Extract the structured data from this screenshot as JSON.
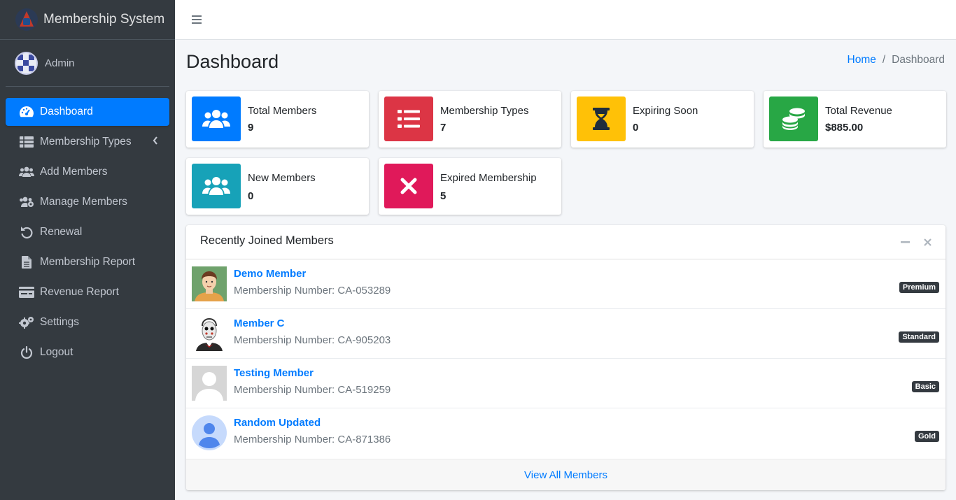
{
  "brand": {
    "title": "Membership System"
  },
  "user": {
    "name": "Admin"
  },
  "sidebar": {
    "items": [
      {
        "label": "Dashboard",
        "icon": "dashboard-icon",
        "active": true
      },
      {
        "label": "Membership Types",
        "icon": "table-icon",
        "has_caret": true
      },
      {
        "label": "Add Members",
        "icon": "users-icon"
      },
      {
        "label": "Manage Members",
        "icon": "users-cog-icon"
      },
      {
        "label": "Renewal",
        "icon": "undo-icon"
      },
      {
        "label": "Membership Report",
        "icon": "file-icon"
      },
      {
        "label": "Revenue Report",
        "icon": "money-check-icon"
      },
      {
        "label": "Settings",
        "icon": "cogs-icon"
      },
      {
        "label": "Logout",
        "icon": "power-icon"
      }
    ]
  },
  "page": {
    "title": "Dashboard",
    "breadcrumb": {
      "home": "Home",
      "separator": "/",
      "current": "Dashboard"
    }
  },
  "stats": [
    {
      "label": "Total Members",
      "value": "9",
      "color": "#007bff",
      "icon": "users-icon"
    },
    {
      "label": "Membership Types",
      "value": "7",
      "color": "#dc3545",
      "icon": "list-icon"
    },
    {
      "label": "Expiring Soon",
      "value": "0",
      "color": "#ffc107",
      "icon": "hourglass-icon"
    },
    {
      "label": "Total Revenue",
      "value": "$885.00",
      "color": "#28a745",
      "icon": "coins-icon"
    },
    {
      "label": "New Members",
      "value": "0",
      "color": "#17a2b8",
      "icon": "users-icon"
    },
    {
      "label": "Expired Membership",
      "value": "5",
      "color": "#e83e8c",
      "icon": "times-icon"
    }
  ],
  "recent": {
    "title": "Recently Joined Members",
    "members": [
      {
        "name": "Demo Member",
        "number": "Membership Number: CA-053289",
        "badge": "Premium"
      },
      {
        "name": "Member C",
        "number": "Membership Number: CA-905203",
        "badge": "Standard"
      },
      {
        "name": "Testing Member",
        "number": "Membership Number: CA-519259",
        "badge": "Basic"
      },
      {
        "name": "Random Updated",
        "number": "Membership Number: CA-871386",
        "badge": "Gold"
      }
    ],
    "footer_link": "View All Members"
  }
}
